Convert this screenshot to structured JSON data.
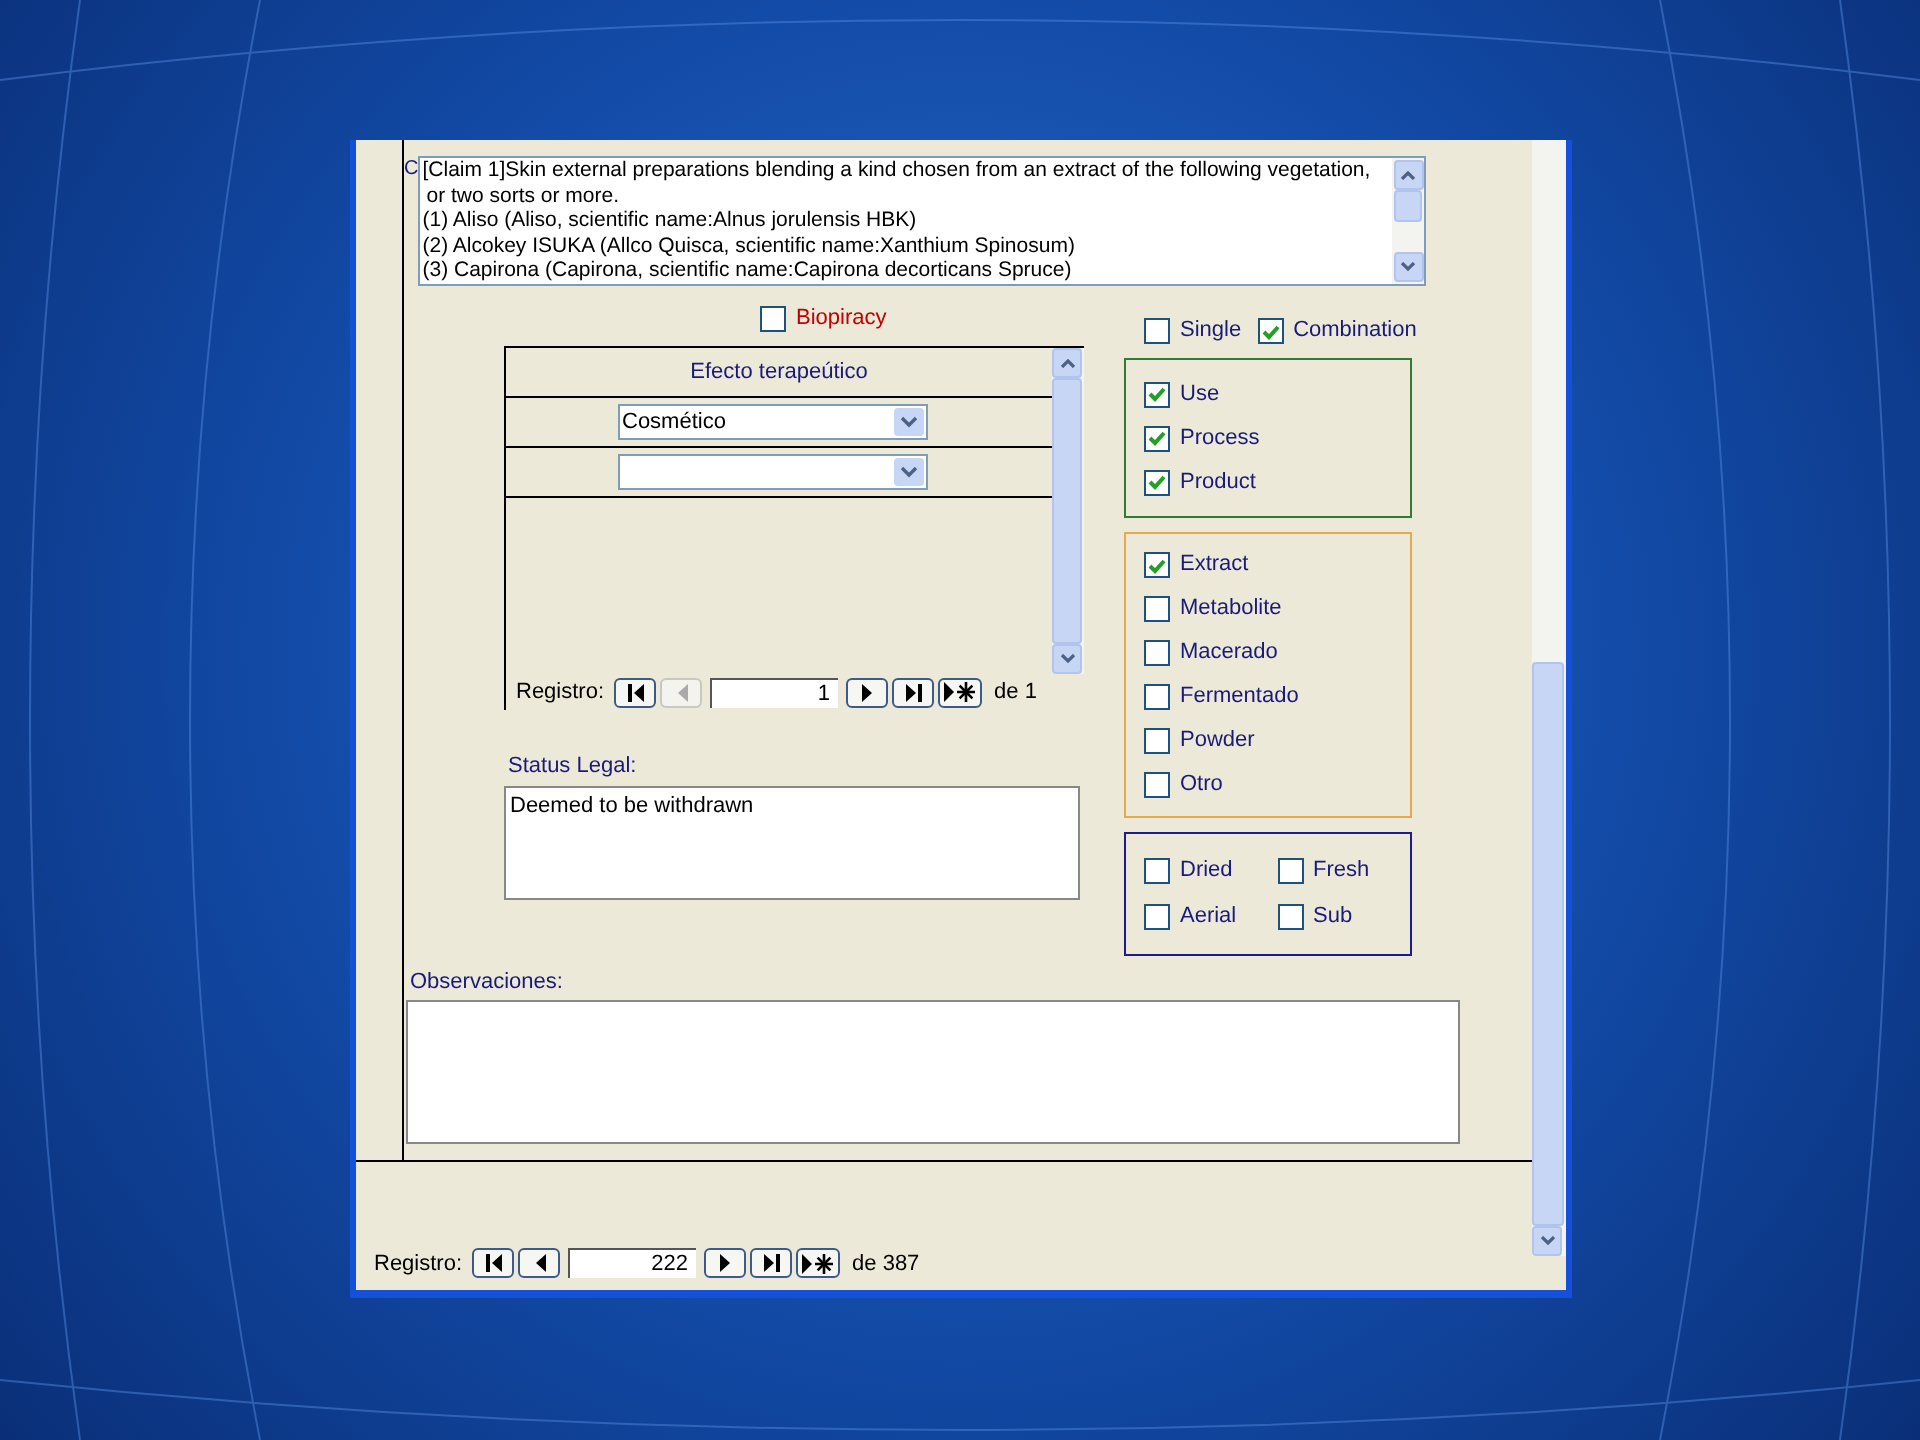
{
  "form": {
    "cut_label": "C",
    "claim_lines": [
      "[Claim 1]Skin external preparations blending a kind chosen from an extract of the following vegetation,",
      "or two sorts or more.",
      "(1) Aliso (Aliso, scientific name:Alnus jorulensis HBK)",
      "(2) Alcokey ISUKA (Allco Quisca, scientific name:Xanthium Spinosum)",
      "(3) Capirona (Capirona, scientific name:Capirona decorticans Spruce)"
    ],
    "biopiracy": {
      "label": "Biopiracy",
      "checked": false
    },
    "mode_options": [
      {
        "label": "Single",
        "checked": false
      },
      {
        "label": "Combination",
        "checked": true
      }
    ],
    "subform": {
      "column_heading": "Efecto terapeútico",
      "rows": [
        {
          "kind": "value",
          "value": "Cosmético"
        },
        {
          "kind": "new"
        }
      ],
      "navigator": {
        "label": "Registro:",
        "current": "1",
        "of_label": "de",
        "total": "1",
        "previous_disabled": true
      }
    },
    "status_legal": {
      "label": "Status Legal:",
      "value": "Deemed to be withdrawn"
    },
    "groups": [
      {
        "color": "#2e7d32",
        "kind": "list",
        "options": [
          {
            "label": "Use",
            "checked": true
          },
          {
            "label": "Process",
            "checked": true
          },
          {
            "label": "Product",
            "checked": true
          }
        ]
      },
      {
        "color": "#e8a84c",
        "kind": "list",
        "options": [
          {
            "label": "Extract",
            "checked": true
          },
          {
            "label": "Metabolite",
            "checked": false
          },
          {
            "label": "Macerado",
            "checked": false
          },
          {
            "label": "Fermentado",
            "checked": false
          },
          {
            "label": "Powder",
            "checked": false
          },
          {
            "label": "Otro",
            "checked": false
          }
        ]
      },
      {
        "color": "#1c1c8c",
        "kind": "grid",
        "options": [
          {
            "label": "Dried",
            "checked": false
          },
          {
            "label": "Fresh",
            "checked": false
          },
          {
            "label": "Aerial",
            "checked": false
          },
          {
            "label": "Sub",
            "checked": false
          }
        ]
      }
    ],
    "observaciones": {
      "label": "Observaciones:"
    }
  },
  "record_navigator": {
    "label": "Registro:",
    "current": "222",
    "of_label": "de",
    "total": "387",
    "previous_disabled": false
  }
}
